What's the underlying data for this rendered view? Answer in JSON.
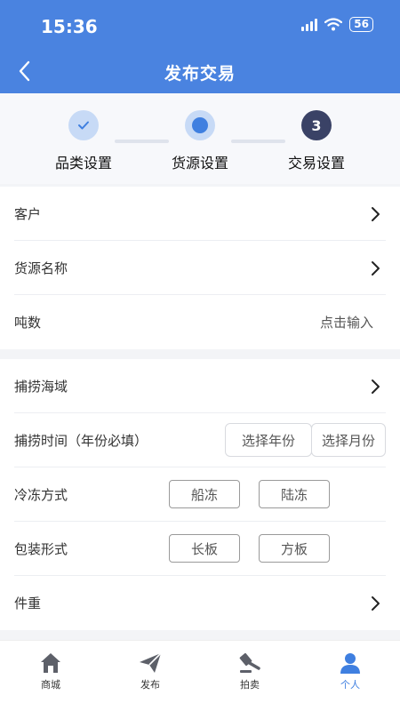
{
  "status_bar": {
    "time": "15:36",
    "battery": "56"
  },
  "nav": {
    "title": "发布交易"
  },
  "steps": [
    {
      "label": "品类设置",
      "state": "done"
    },
    {
      "label": "货源设置",
      "state": "current"
    },
    {
      "label": "交易设置",
      "state": "pending",
      "number": "3"
    }
  ],
  "form": {
    "customer_label": "客户",
    "source_name_label": "货源名称",
    "tonnage_label": "吨数",
    "tonnage_placeholder": "点击输入",
    "fishing_area_label": "捕捞海域",
    "fishing_time_label": "捕捞时间（年份必填）",
    "select_year": "选择年份",
    "select_month": "选择月份",
    "freeze_label": "冷冻方式",
    "freeze_options": [
      "船冻",
      "陆冻"
    ],
    "packing_label": "包装形式",
    "packing_options": [
      "长板",
      "方板"
    ],
    "piece_weight_label": "件重"
  },
  "tabbar": [
    {
      "label": "商城",
      "icon": "home-icon"
    },
    {
      "label": "发布",
      "icon": "send-icon"
    },
    {
      "label": "拍卖",
      "icon": "auction-hammer-icon"
    },
    {
      "label": "个人",
      "icon": "user-icon",
      "active": true
    }
  ],
  "colors": {
    "primary": "#4a83e0",
    "step_dark": "#3a4266",
    "active_tab": "#3f7fe0"
  }
}
